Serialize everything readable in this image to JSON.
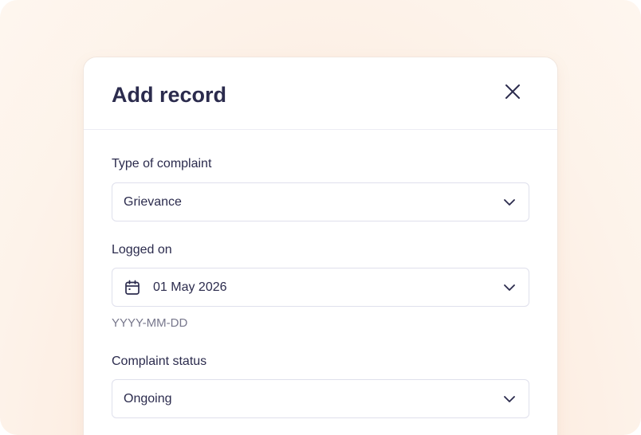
{
  "modal": {
    "title": "Add record"
  },
  "fields": {
    "complaint_type": {
      "label": "Type of complaint",
      "value": "Grievance"
    },
    "logged_on": {
      "label": "Logged on",
      "value": "01 May 2026",
      "helper": "YYYY-MM-DD"
    },
    "complaint_status": {
      "label": "Complaint status",
      "value": "Ongoing"
    }
  },
  "icons": {
    "close": "close-icon",
    "chevron": "chevron-down-icon",
    "calendar": "calendar-icon"
  },
  "colors": {
    "text": "#2b2b4d",
    "muted": "#77778c",
    "border": "#dfe0ec",
    "backdrop": "#fdebdf"
  }
}
